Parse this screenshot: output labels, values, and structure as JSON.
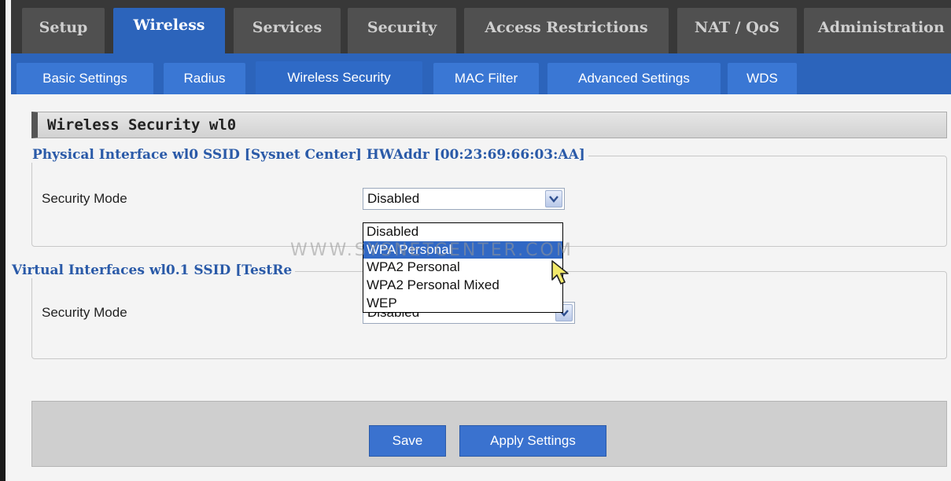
{
  "top_nav": {
    "tabs": [
      {
        "label": "Setup"
      },
      {
        "label": "Wireless"
      },
      {
        "label": "Services"
      },
      {
        "label": "Security"
      },
      {
        "label": "Access Restrictions"
      },
      {
        "label": "NAT / QoS"
      },
      {
        "label": "Administration"
      }
    ],
    "active": "Wireless"
  },
  "sub_nav": {
    "tabs": [
      {
        "label": "Basic Settings"
      },
      {
        "label": "Radius"
      },
      {
        "label": "Wireless Security"
      },
      {
        "label": "MAC Filter"
      },
      {
        "label": "Advanced Settings"
      },
      {
        "label": "WDS"
      }
    ],
    "active": "Wireless Security"
  },
  "section": {
    "title": "Wireless Security wl0"
  },
  "physical_interface": {
    "legend": "Physical Interface wl0 SSID [Sysnet Center] HWAddr [00:23:69:66:03:AA]",
    "security_mode_label": "Security Mode",
    "security_mode_value": "Disabled",
    "options": [
      "Disabled",
      "WPA Personal",
      "WPA2 Personal",
      "WPA2 Personal Mixed",
      "WEP"
    ],
    "highlighted_option": "WPA Personal"
  },
  "virtual_interface": {
    "legend": "Virtual Interfaces wl0.1 SSID [TestRe",
    "security_mode_label": "Security Mode",
    "security_mode_value": "Disabled"
  },
  "watermark": "WWW.SYSNETCENTER.COM",
  "buttons": {
    "save": "Save",
    "apply": "Apply Settings"
  },
  "colors": {
    "accent": "#2c64bb",
    "nav_dark": "#383838",
    "legend_blue": "#2a5aa8",
    "selected_option": "#3168c4"
  },
  "icons": {
    "dropdown_arrow": "chevron-down-icon",
    "cursor": "hand-pointer-icon"
  }
}
